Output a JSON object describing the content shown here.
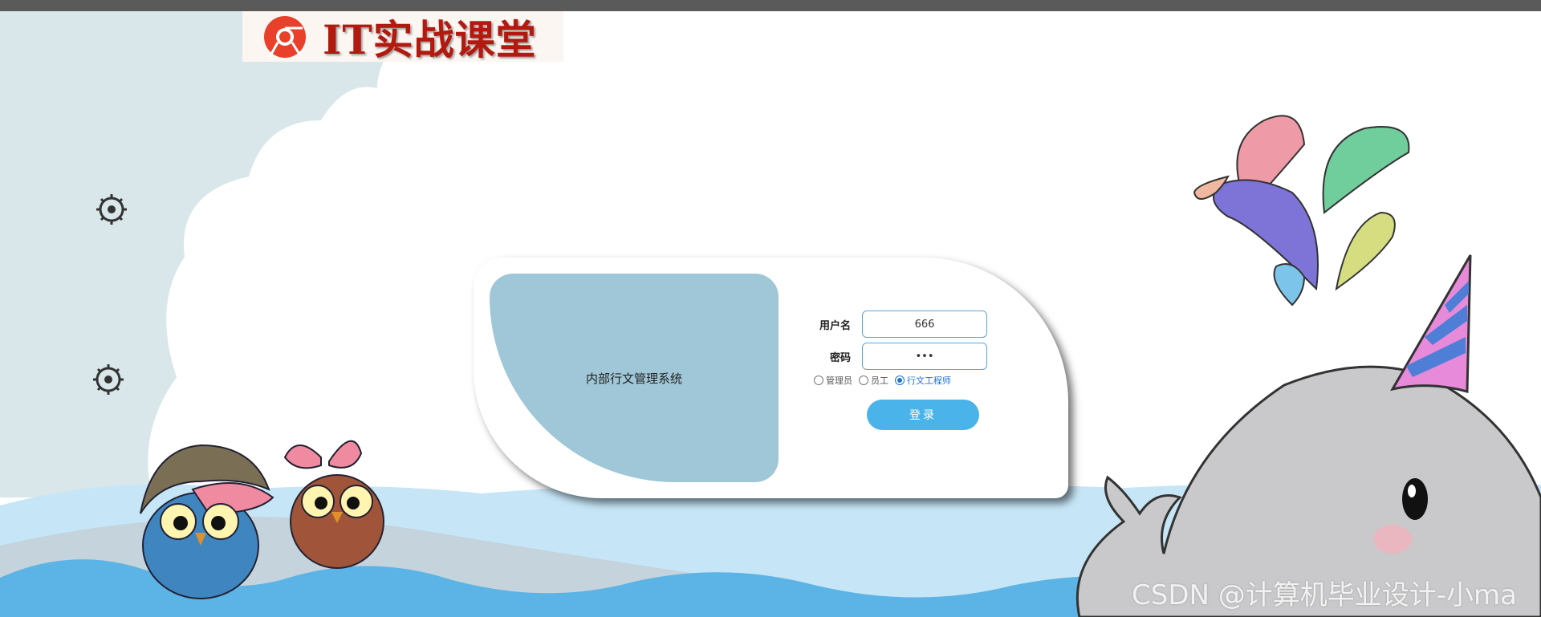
{
  "brand": {
    "name": "IT实战课堂"
  },
  "login": {
    "system_title": "内部行文管理系统",
    "username_label": "用户名",
    "username_value": "666",
    "password_label": "密码",
    "password_value": "•••",
    "roles": [
      {
        "label": "管理员",
        "checked": false
      },
      {
        "label": "员工",
        "checked": false
      },
      {
        "label": "行文工程师",
        "checked": true
      }
    ],
    "submit_label": "登录"
  },
  "watermark": "CSDN @计算机毕业设计-小ma",
  "colors": {
    "accent": "#4ab4ea",
    "panel": "#9fc7d7",
    "water": "#5bb3e6",
    "brand_red": "#b21a10"
  }
}
